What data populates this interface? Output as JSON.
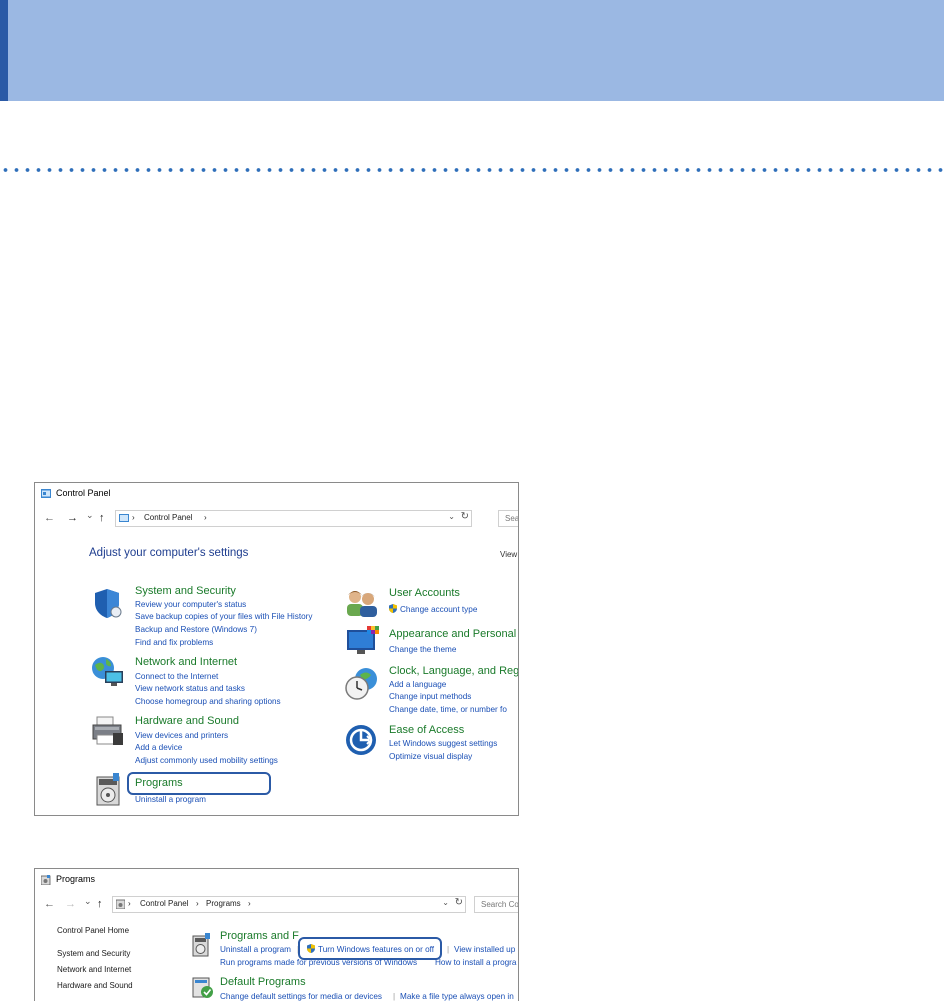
{
  "colors": {
    "banner": "#9bb8e3",
    "accent": "#2b5aa6",
    "dots": "#2f6fba",
    "category": "#1a7a2a",
    "link": "#1a4fb5"
  },
  "window1": {
    "title": "Control Panel",
    "nav": {
      "back": "←",
      "forward": "→",
      "recent": "⌄",
      "up": "↑"
    },
    "address_crumb": "Control Panel",
    "search_placeholder": "Sea",
    "heading": "Adjust your computer's settings",
    "view_by": "View",
    "categories": [
      {
        "title": "System and Security",
        "icon": "shield-icon",
        "links": [
          "Review your computer's status",
          "Save backup copies of your files with File History",
          "Backup and Restore (Windows 7)",
          "Find and fix problems"
        ]
      },
      {
        "title": "Network and Internet",
        "icon": "globe-network-icon",
        "links": [
          "Connect to the Internet",
          "View network status and tasks",
          "Choose homegroup and sharing options"
        ]
      },
      {
        "title": "Hardware and Sound",
        "icon": "printer-icon",
        "links": [
          "View devices and printers",
          "Add a device",
          "Adjust commonly used mobility settings"
        ]
      },
      {
        "title": "Programs",
        "icon": "programs-icon",
        "links": [
          "Uninstall a program"
        ]
      },
      {
        "title": "User Accounts",
        "icon": "users-icon",
        "links": [
          "Change account type"
        ]
      },
      {
        "title": "Appearance and Personal",
        "icon": "appearance-icon",
        "links": [
          "Change the theme"
        ]
      },
      {
        "title": "Clock, Language, and Reg",
        "icon": "clock-globe-icon",
        "links": [
          "Add a language",
          "Change input methods",
          "Change date, time, or number fo"
        ]
      },
      {
        "title": "Ease of Access",
        "icon": "ease-of-access-icon",
        "links": [
          "Let Windows suggest settings",
          "Optimize visual display"
        ]
      }
    ]
  },
  "window2": {
    "title": "Programs",
    "address_crumbs": [
      "Control Panel",
      "Programs"
    ],
    "search_placeholder": "Search Co",
    "sidebar": [
      "Control Panel Home",
      "System and Security",
      "Network and Internet",
      "Hardware and Sound"
    ],
    "section1": {
      "title": "Programs and F",
      "links": [
        "Uninstall a program",
        "Turn Windows features on or off",
        "View installed up",
        "Run programs made for previous versions of Windows",
        "How to install a progra"
      ]
    },
    "section2": {
      "title": "Default Programs",
      "links": [
        "Change default settings for media or devices",
        "Make a file type always open in"
      ]
    }
  }
}
